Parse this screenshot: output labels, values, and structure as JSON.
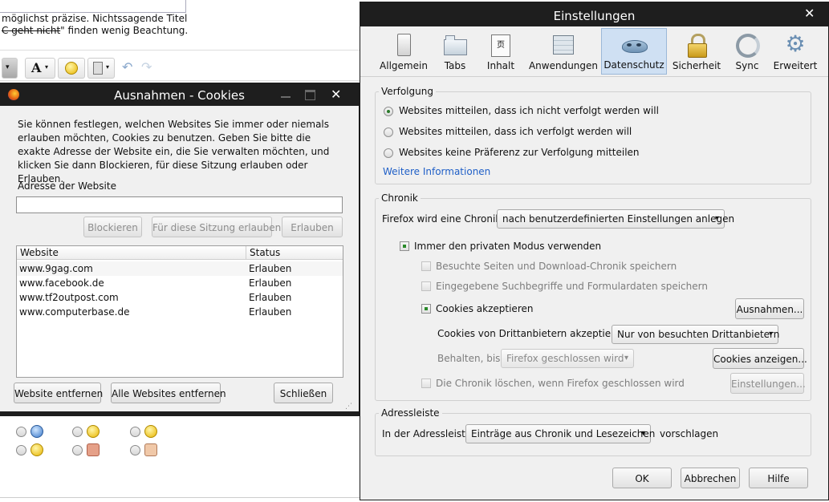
{
  "background_page": {
    "hint_line1": "möglichst präzise. Nichtssagende Titel",
    "hint_line2_struck": "C geht nicht",
    "hint_line2_rest": "\" finden wenig Beachtung.",
    "toolbar_font_label": "A"
  },
  "cookies_dialog": {
    "title": "Ausnahmen - Cookies",
    "description": "Sie können festlegen, welchen Websites Sie immer oder niemals erlauben möchten, Cookies zu benutzen. Geben Sie bitte die exakte Adresse der Website ein, die Sie verwalten möchten, und klicken Sie dann Blockieren, für diese Sitzung erlauben oder Erlauben.",
    "address_label": "Adresse der Website",
    "address_value": "",
    "buttons": {
      "block": "Blockieren",
      "allow_session": "Für diese Sitzung erlauben",
      "allow": "Erlauben",
      "remove_site": "Website entfernen",
      "remove_all": "Alle Websites entfernen",
      "close": "Schließen"
    },
    "columns": {
      "site": "Website",
      "status": "Status"
    },
    "rows": [
      {
        "site": "www.9gag.com",
        "status": "Erlauben"
      },
      {
        "site": "www.facebook.de",
        "status": "Erlauben"
      },
      {
        "site": "www.tf2outpost.com",
        "status": "Erlauben"
      },
      {
        "site": "www.computerbase.de",
        "status": "Erlauben"
      }
    ]
  },
  "settings_dialog": {
    "title": "Einstellungen",
    "tabs": [
      {
        "label": "Allgemein",
        "icon": "general-icon"
      },
      {
        "label": "Tabs",
        "icon": "tabs-icon"
      },
      {
        "label": "Inhalt",
        "icon": "content-icon"
      },
      {
        "label": "Anwendungen",
        "icon": "applications-icon"
      },
      {
        "label": "Datenschutz",
        "icon": "privacy-mask-icon",
        "selected": true
      },
      {
        "label": "Sicherheit",
        "icon": "lock-icon"
      },
      {
        "label": "Sync",
        "icon": "sync-icon"
      },
      {
        "label": "Erweitert",
        "icon": "gear-icon"
      }
    ],
    "tracking": {
      "legend": "Verfolgung",
      "options": [
        {
          "label": "Websites mitteilen, dass ich nicht verfolgt werden will",
          "selected": true
        },
        {
          "label": "Websites mitteilen, dass ich verfolgt werden will",
          "selected": false
        },
        {
          "label": "Websites keine Präferenz zur Verfolgung mitteilen",
          "selected": false
        }
      ],
      "more_info": "Weitere Informationen"
    },
    "history": {
      "legend": "Chronik",
      "mode_label": "Firefox wird eine Chronik:",
      "mode_value": "nach benutzerdefinierten Einstellungen anlegen",
      "private_mode": "Immer den privaten Modus verwenden",
      "visited": "Besuchte Seiten und Download-Chronik speichern",
      "searches": "Eingegebene Suchbegriffe und Formulardaten speichern",
      "accept_cookies": "Cookies akzeptieren",
      "exceptions_button": "Ausnahmen...",
      "third_party_label": "Cookies von Drittanbietern akzeptieren:",
      "third_party_value": "Nur von besuchten Drittanbietern",
      "keep_label": "Behalten, bis:",
      "keep_value": "Firefox geschlossen wird",
      "show_cookies_button": "Cookies anzeigen...",
      "clear_on_close": "Die Chronik löschen, wenn Firefox geschlossen wird",
      "settings_button": "Einstellungen..."
    },
    "address_bar": {
      "legend": "Adressleiste",
      "prefix": "In der Adressleiste",
      "value": "Einträge aus Chronik und Lesezeichen",
      "suffix": "vorschlagen"
    },
    "footer": {
      "ok": "OK",
      "cancel": "Abbrechen",
      "help": "Hilfe"
    }
  },
  "colors": {
    "titlebar": "#1e1e1e",
    "dialog_bg": "#f0f0f0",
    "link": "#1f5fc7",
    "selected_tab": "#cfe0f3"
  }
}
